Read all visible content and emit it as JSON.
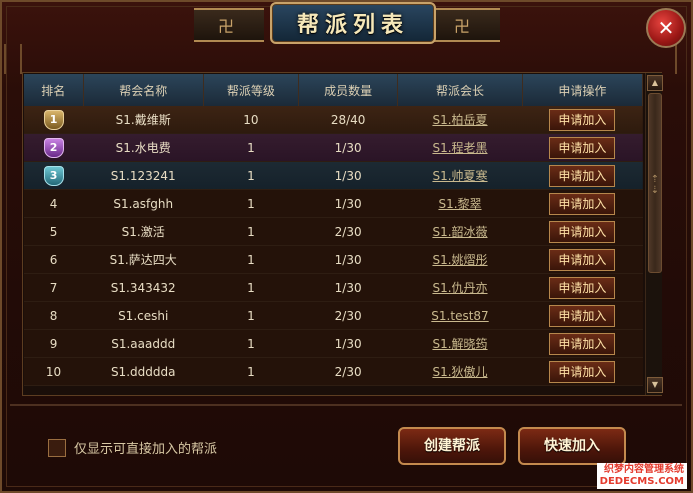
{
  "title": "帮派列表",
  "close_label": "✕",
  "table": {
    "headers": [
      "排名",
      "帮会名称",
      "帮派等级",
      "成员数量",
      "帮派会长",
      "申请操作"
    ],
    "rows": [
      {
        "rank": "1",
        "name": "S1.戴维斯",
        "level": "10",
        "members": "28/40",
        "leader": "S1.柏岳夏",
        "action": "申请加入"
      },
      {
        "rank": "2",
        "name": "S1.水电费",
        "level": "1",
        "members": "1/30",
        "leader": "S1.程老黑",
        "action": "申请加入"
      },
      {
        "rank": "3",
        "name": "S1.123241",
        "level": "1",
        "members": "1/30",
        "leader": "S1.帅夏寒",
        "action": "申请加入"
      },
      {
        "rank": "4",
        "name": "S1.asfghh",
        "level": "1",
        "members": "1/30",
        "leader": "S1.黎翠",
        "action": "申请加入"
      },
      {
        "rank": "5",
        "name": "S1.激活",
        "level": "1",
        "members": "2/30",
        "leader": "S1.韶冰薇",
        "action": "申请加入"
      },
      {
        "rank": "6",
        "name": "S1.萨达四大",
        "level": "1",
        "members": "1/30",
        "leader": "S1.姚熠彤",
        "action": "申请加入"
      },
      {
        "rank": "7",
        "name": "S1.343432",
        "level": "1",
        "members": "1/30",
        "leader": "S1.仇丹亦",
        "action": "申请加入"
      },
      {
        "rank": "8",
        "name": "S1.ceshi",
        "level": "1",
        "members": "2/30",
        "leader": "S1.test87",
        "action": "申请加入"
      },
      {
        "rank": "9",
        "name": "S1.aaaddd",
        "level": "1",
        "members": "1/30",
        "leader": "S1.解晓筠",
        "action": "申请加入"
      },
      {
        "rank": "10",
        "name": "S1.ddddda",
        "level": "1",
        "members": "2/30",
        "leader": "S1.狄傲儿",
        "action": "申请加入"
      }
    ]
  },
  "filter_checkbox_label": "仅显示可直接加入的帮派",
  "buttons": {
    "create": "创建帮派",
    "quick_join": "快速加入"
  },
  "watermark": {
    "line1": "织梦内容管理系统",
    "line2": "DEDECMS.COM"
  },
  "colors": {
    "title_plate": "#1f3a52",
    "frame_bg": "#2a0d08",
    "button_border": "#c48a4e",
    "close_button": "#b21f1c"
  },
  "icons": {
    "close": "close-icon",
    "scroll_up": "chevron-up-icon",
    "scroll_down": "chevron-down-icon",
    "rank_medals": [
      "gold-medal-icon",
      "purple-medal-icon",
      "teal-medal-icon"
    ]
  }
}
